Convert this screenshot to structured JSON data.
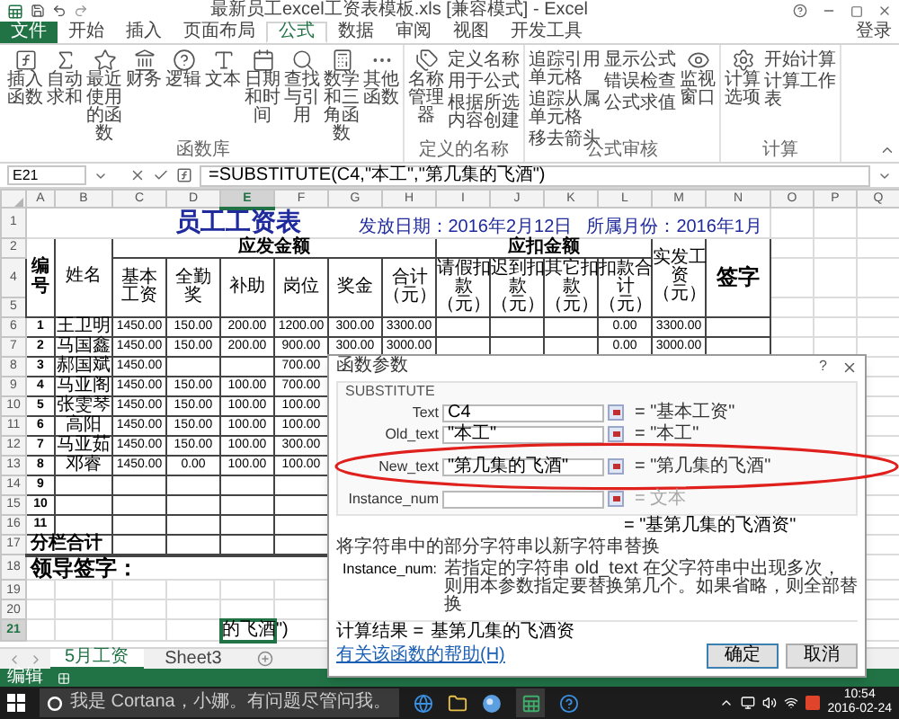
{
  "title_bar": {
    "title": "最新员工excel工资表模板.xls  [兼容模式] - Excel"
  },
  "ribbon_tabs": [
    {
      "label": "文件",
      "selected": false,
      "kind": "file"
    },
    {
      "label": "开始",
      "selected": false,
      "kind": "tab"
    },
    {
      "label": "插入",
      "selected": false,
      "kind": "tab"
    },
    {
      "label": "页面布局",
      "selected": false,
      "kind": "tab"
    },
    {
      "label": "公式",
      "selected": true,
      "kind": "tab"
    },
    {
      "label": "数据",
      "selected": false,
      "kind": "tab"
    },
    {
      "label": "审阅",
      "selected": false,
      "kind": "tab"
    },
    {
      "label": "视图",
      "selected": false,
      "kind": "tab"
    },
    {
      "label": "开发工具",
      "selected": false,
      "kind": "tab"
    }
  ],
  "sign_in": "登录",
  "ribbon_groups": [
    {
      "label": "函数库",
      "items": [
        {
          "label": "插入函数",
          "kind": "large"
        },
        {
          "label": "自动求和",
          "kind": "large"
        },
        {
          "label": "最近使用的函数",
          "kind": "large"
        },
        {
          "label": "财务",
          "kind": "large"
        },
        {
          "label": "逻辑",
          "kind": "large"
        },
        {
          "label": "文本",
          "kind": "large"
        },
        {
          "label": "日期和时间",
          "kind": "large"
        },
        {
          "label": "查找与引用",
          "kind": "large"
        },
        {
          "label": "数学和三角函数",
          "kind": "large"
        },
        {
          "label": "其他函数",
          "kind": "large"
        }
      ]
    },
    {
      "label": "定义的名称",
      "items": [
        {
          "label": "名称管理器",
          "kind": "large"
        },
        {
          "label": "定义名称",
          "kind": "small"
        },
        {
          "label": "用于公式",
          "kind": "small"
        },
        {
          "label": "根据所选内容创建",
          "kind": "small"
        }
      ]
    },
    {
      "label": "公式审核",
      "items": [
        {
          "label": "追踪引用单元格",
          "kind": "small"
        },
        {
          "label": "追踪从属单元格",
          "kind": "small"
        },
        {
          "label": "移去箭头",
          "kind": "small"
        },
        {
          "label": "显示公式",
          "kind": "small"
        },
        {
          "label": "错误检查",
          "kind": "small"
        },
        {
          "label": "公式求值",
          "kind": "small"
        },
        {
          "label": "监视窗口",
          "kind": "large"
        }
      ]
    },
    {
      "label": "计算",
      "items": [
        {
          "label": "计算选项",
          "kind": "large"
        },
        {
          "label": "开始计算",
          "kind": "small"
        },
        {
          "label": "计算工作表",
          "kind": "small"
        }
      ]
    }
  ],
  "formula_bar": {
    "name_box": "E21",
    "formula": "=SUBSTITUTE(C4,\"本工\",\"第几集的飞酒\")"
  },
  "columns": [
    {
      "label": "A",
      "selected": false
    },
    {
      "label": "B",
      "selected": false
    },
    {
      "label": "C",
      "selected": false
    },
    {
      "label": "D",
      "selected": false
    },
    {
      "label": "E",
      "selected": true
    },
    {
      "label": "F",
      "selected": false
    },
    {
      "label": "G",
      "selected": false
    },
    {
      "label": "H",
      "selected": false
    },
    {
      "label": "I",
      "selected": false
    },
    {
      "label": "J",
      "selected": false
    },
    {
      "label": "K",
      "selected": false
    },
    {
      "label": "L",
      "selected": false
    },
    {
      "label": "M",
      "selected": false
    },
    {
      "label": "N",
      "selected": false
    },
    {
      "label": "O",
      "selected": false
    },
    {
      "label": "P",
      "selected": false
    },
    {
      "label": "Q",
      "selected": false
    }
  ],
  "sheet": {
    "title": "员工工资表",
    "issue_date": "发放日期：2016年2月12日",
    "pay_month": "所属月份：2016年1月",
    "header_rows": [
      "1",
      "2",
      "4",
      "5"
    ],
    "header_no": "编号",
    "header_name": "姓名",
    "group_pay": "应发金额",
    "group_deduct": "应扣金额",
    "pay_headers": [
      "基本工资",
      "全勤奖",
      "补助",
      "岗位",
      "奖金",
      "合计（元）"
    ],
    "deduct_headers": [
      "请假扣款（元）",
      "迟到扣款（元）",
      "其它扣款（元）",
      "扣款合计（元）"
    ],
    "net_header": "实发工资（元）",
    "sign_header": "签字",
    "rows": [
      {
        "row": "6",
        "no": "1",
        "name": "王卫明",
        "cells": {
          "C": "1450.00",
          "D": "150.00",
          "E": "200.00",
          "F": "1200.00",
          "G": "300.00",
          "H": "3300.00",
          "L": "0.00",
          "M": "3300.00"
        }
      },
      {
        "row": "7",
        "no": "2",
        "name": "马国鑫",
        "cells": {
          "C": "1450.00",
          "D": "150.00",
          "E": "200.00",
          "F": "900.00",
          "G": "300.00",
          "H": "3000.00",
          "L": "0.00",
          "M": "3000.00"
        }
      },
      {
        "row": "8",
        "no": "3",
        "name": "郝国斌",
        "cells": {
          "C": "1450.00",
          "F": "700.00"
        }
      },
      {
        "row": "9",
        "no": "4",
        "name": "马亚阁",
        "cells": {
          "C": "1450.00",
          "D": "150.00",
          "E": "100.00",
          "F": "700.00"
        }
      },
      {
        "row": "10",
        "no": "5",
        "name": "张雯琴",
        "cells": {
          "C": "1450.00",
          "D": "150.00",
          "E": "100.00",
          "F": "100.00"
        }
      },
      {
        "row": "11",
        "no": "6",
        "name": "高阳",
        "cells": {
          "C": "1450.00",
          "D": "150.00",
          "E": "100.00",
          "F": "100.00"
        }
      },
      {
        "row": "12",
        "no": "7",
        "name": "马亚茹",
        "cells": {
          "C": "1450.00",
          "D": "150.00",
          "E": "100.00",
          "F": "300.00"
        }
      },
      {
        "row": "13",
        "no": "8",
        "name": "邓睿",
        "cells": {
          "C": "1450.00",
          "D": "0.00",
          "E": "100.00",
          "F": "100.00"
        }
      },
      {
        "row": "14",
        "no": "9",
        "cells": {}
      },
      {
        "row": "15",
        "no": "10",
        "cells": {}
      },
      {
        "row": "16",
        "no": "11",
        "cells": {}
      }
    ],
    "subtotal": {
      "row": "17",
      "label": "分栏合计"
    },
    "leader": {
      "row": "18",
      "label": "领导签字："
    },
    "blank_rows": [
      {
        "row": "19",
        "selected": false
      },
      {
        "row": "20",
        "selected": false
      },
      {
        "row": "21",
        "selected": true
      }
    ],
    "active_cell_text": "的飞酒\")"
  },
  "dialog": {
    "title": "函数参数",
    "help": "?",
    "function": "SUBSTITUTE",
    "args": [
      {
        "label": "Text",
        "value": "C4",
        "result": "= \"基本工资\"",
        "disabled": false
      },
      {
        "label": "Old_text",
        "value": "\"本工\"",
        "result": "= \"本工\"",
        "disabled": false
      },
      {
        "label": "New_text",
        "value": "\"第几集的飞酒\"",
        "result": "= \"第几集的飞酒\"",
        "disabled": false
      },
      {
        "label": "Instance_num",
        "result": "= 文本",
        "disabled": true
      }
    ],
    "overall": "= \"基第几集的飞酒资\"",
    "description": "将字符串中的部分字符串以新字符串替换",
    "arg_help_label": "Instance_num:",
    "arg_help": "若指定的字符串 old_text 在父字符串中出现多次，则用本参数指定要替换第几个。如果省略，则全部替换",
    "result_label": "计算结果 =",
    "result_value": "基第几集的飞酒资",
    "help_link": "有关该函数的帮助(H)",
    "buttons": [
      {
        "label": "确定",
        "kind": "default"
      },
      {
        "label": "取消",
        "kind": "normal"
      }
    ]
  },
  "sheet_tabs": [
    {
      "label": "5月工资",
      "selected": true
    },
    {
      "label": "Sheet3",
      "selected": false
    }
  ],
  "status_bar": {
    "mode": "编辑"
  },
  "taskbar": {
    "search": "我是 Cortana，小娜。有问题尽管问我。",
    "time": "10:54",
    "date": "2016-02-24"
  }
}
